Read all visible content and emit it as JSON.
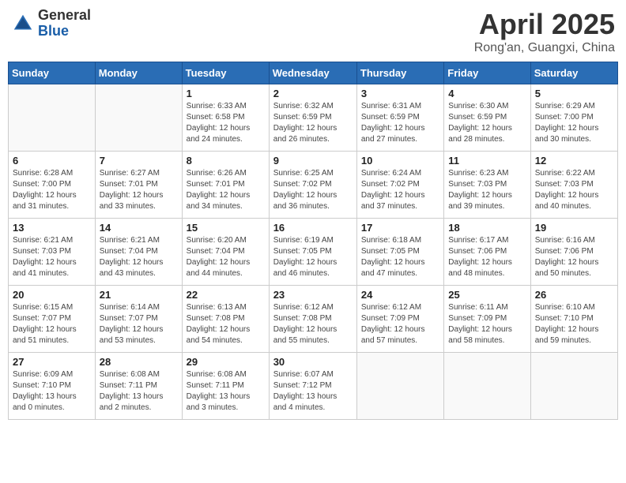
{
  "header": {
    "logo_general": "General",
    "logo_blue": "Blue",
    "month_title": "April 2025",
    "location": "Rong'an, Guangxi, China"
  },
  "weekdays": [
    "Sunday",
    "Monday",
    "Tuesday",
    "Wednesday",
    "Thursday",
    "Friday",
    "Saturday"
  ],
  "weeks": [
    [
      {
        "day": "",
        "info": ""
      },
      {
        "day": "",
        "info": ""
      },
      {
        "day": "1",
        "info": "Sunrise: 6:33 AM\nSunset: 6:58 PM\nDaylight: 12 hours\nand 24 minutes."
      },
      {
        "day": "2",
        "info": "Sunrise: 6:32 AM\nSunset: 6:59 PM\nDaylight: 12 hours\nand 26 minutes."
      },
      {
        "day": "3",
        "info": "Sunrise: 6:31 AM\nSunset: 6:59 PM\nDaylight: 12 hours\nand 27 minutes."
      },
      {
        "day": "4",
        "info": "Sunrise: 6:30 AM\nSunset: 6:59 PM\nDaylight: 12 hours\nand 28 minutes."
      },
      {
        "day": "5",
        "info": "Sunrise: 6:29 AM\nSunset: 7:00 PM\nDaylight: 12 hours\nand 30 minutes."
      }
    ],
    [
      {
        "day": "6",
        "info": "Sunrise: 6:28 AM\nSunset: 7:00 PM\nDaylight: 12 hours\nand 31 minutes."
      },
      {
        "day": "7",
        "info": "Sunrise: 6:27 AM\nSunset: 7:01 PM\nDaylight: 12 hours\nand 33 minutes."
      },
      {
        "day": "8",
        "info": "Sunrise: 6:26 AM\nSunset: 7:01 PM\nDaylight: 12 hours\nand 34 minutes."
      },
      {
        "day": "9",
        "info": "Sunrise: 6:25 AM\nSunset: 7:02 PM\nDaylight: 12 hours\nand 36 minutes."
      },
      {
        "day": "10",
        "info": "Sunrise: 6:24 AM\nSunset: 7:02 PM\nDaylight: 12 hours\nand 37 minutes."
      },
      {
        "day": "11",
        "info": "Sunrise: 6:23 AM\nSunset: 7:03 PM\nDaylight: 12 hours\nand 39 minutes."
      },
      {
        "day": "12",
        "info": "Sunrise: 6:22 AM\nSunset: 7:03 PM\nDaylight: 12 hours\nand 40 minutes."
      }
    ],
    [
      {
        "day": "13",
        "info": "Sunrise: 6:21 AM\nSunset: 7:03 PM\nDaylight: 12 hours\nand 41 minutes."
      },
      {
        "day": "14",
        "info": "Sunrise: 6:21 AM\nSunset: 7:04 PM\nDaylight: 12 hours\nand 43 minutes."
      },
      {
        "day": "15",
        "info": "Sunrise: 6:20 AM\nSunset: 7:04 PM\nDaylight: 12 hours\nand 44 minutes."
      },
      {
        "day": "16",
        "info": "Sunrise: 6:19 AM\nSunset: 7:05 PM\nDaylight: 12 hours\nand 46 minutes."
      },
      {
        "day": "17",
        "info": "Sunrise: 6:18 AM\nSunset: 7:05 PM\nDaylight: 12 hours\nand 47 minutes."
      },
      {
        "day": "18",
        "info": "Sunrise: 6:17 AM\nSunset: 7:06 PM\nDaylight: 12 hours\nand 48 minutes."
      },
      {
        "day": "19",
        "info": "Sunrise: 6:16 AM\nSunset: 7:06 PM\nDaylight: 12 hours\nand 50 minutes."
      }
    ],
    [
      {
        "day": "20",
        "info": "Sunrise: 6:15 AM\nSunset: 7:07 PM\nDaylight: 12 hours\nand 51 minutes."
      },
      {
        "day": "21",
        "info": "Sunrise: 6:14 AM\nSunset: 7:07 PM\nDaylight: 12 hours\nand 53 minutes."
      },
      {
        "day": "22",
        "info": "Sunrise: 6:13 AM\nSunset: 7:08 PM\nDaylight: 12 hours\nand 54 minutes."
      },
      {
        "day": "23",
        "info": "Sunrise: 6:12 AM\nSunset: 7:08 PM\nDaylight: 12 hours\nand 55 minutes."
      },
      {
        "day": "24",
        "info": "Sunrise: 6:12 AM\nSunset: 7:09 PM\nDaylight: 12 hours\nand 57 minutes."
      },
      {
        "day": "25",
        "info": "Sunrise: 6:11 AM\nSunset: 7:09 PM\nDaylight: 12 hours\nand 58 minutes."
      },
      {
        "day": "26",
        "info": "Sunrise: 6:10 AM\nSunset: 7:10 PM\nDaylight: 12 hours\nand 59 minutes."
      }
    ],
    [
      {
        "day": "27",
        "info": "Sunrise: 6:09 AM\nSunset: 7:10 PM\nDaylight: 13 hours\nand 0 minutes."
      },
      {
        "day": "28",
        "info": "Sunrise: 6:08 AM\nSunset: 7:11 PM\nDaylight: 13 hours\nand 2 minutes."
      },
      {
        "day": "29",
        "info": "Sunrise: 6:08 AM\nSunset: 7:11 PM\nDaylight: 13 hours\nand 3 minutes."
      },
      {
        "day": "30",
        "info": "Sunrise: 6:07 AM\nSunset: 7:12 PM\nDaylight: 13 hours\nand 4 minutes."
      },
      {
        "day": "",
        "info": ""
      },
      {
        "day": "",
        "info": ""
      },
      {
        "day": "",
        "info": ""
      }
    ]
  ]
}
